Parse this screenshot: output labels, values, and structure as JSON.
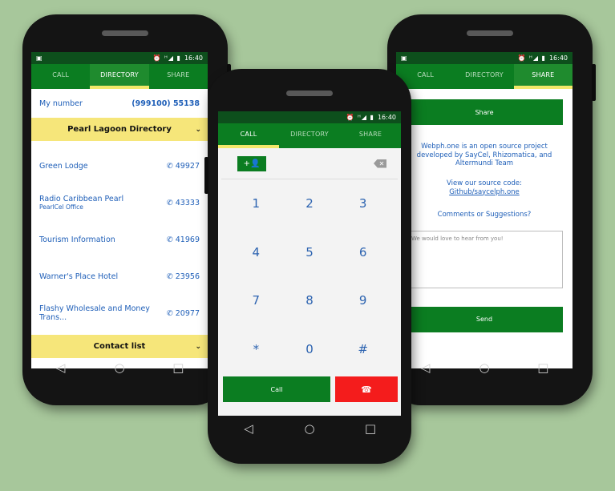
{
  "status": {
    "time": "16:40",
    "icons": "⏰ ᴴ◢ ▮"
  },
  "tabs": [
    "CALL",
    "DIRECTORY",
    "SHARE"
  ],
  "directory": {
    "my_number_label": "My number",
    "my_number_value": "(999100) 55138",
    "section_title": "Pearl Lagoon Directory",
    "entries": [
      {
        "name": "Green Lodge",
        "sub": "",
        "number": "49927"
      },
      {
        "name": "Radio Caribbean Pearl",
        "sub": "PearlCel Office",
        "number": "43333"
      },
      {
        "name": "Tourism Information",
        "sub": "",
        "number": "41969"
      },
      {
        "name": "Warner's Place Hotel",
        "sub": "",
        "number": "23956"
      },
      {
        "name": "Flashy Wholesale and Money Trans...",
        "sub": "",
        "number": "20977"
      }
    ],
    "contact_list_title": "Contact list"
  },
  "dialer": {
    "keys": [
      "1",
      "2",
      "3",
      "4",
      "5",
      "6",
      "7",
      "8",
      "9",
      "*",
      "0",
      "#"
    ],
    "call_label": "Call"
  },
  "share": {
    "share_button": "Share",
    "about_text": "Webph.one is an open source project developed by SayCel, Rhizomatica, and Altermundi Team",
    "source_label": "View our source code:",
    "source_link": "Github/saycelph.one",
    "comments_label": "Comments or Suggestions?",
    "comment_placeholder": "We would love to hear from you!",
    "send_button": "Send"
  }
}
